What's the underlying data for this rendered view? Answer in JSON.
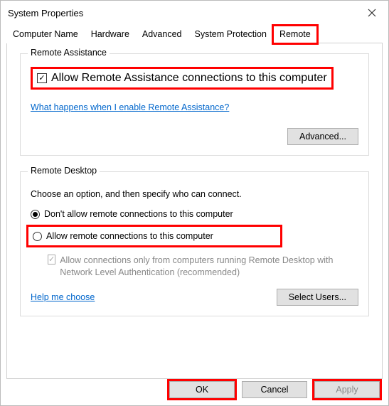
{
  "window": {
    "title": "System Properties"
  },
  "tabs": {
    "items": [
      {
        "label": "Computer Name"
      },
      {
        "label": "Hardware"
      },
      {
        "label": "Advanced"
      },
      {
        "label": "System Protection"
      },
      {
        "label": "Remote"
      }
    ],
    "active": 4,
    "highlight": 4
  },
  "remote_assistance": {
    "legend": "Remote Assistance",
    "checkbox_label": "Allow Remote Assistance connections to this computer",
    "checkbox_checked": true,
    "help_link": "What happens when I enable Remote Assistance?",
    "advanced_button": "Advanced..."
  },
  "remote_desktop": {
    "legend": "Remote Desktop",
    "instruction": "Choose an option, and then specify who can connect.",
    "options": [
      {
        "label": "Don't allow remote connections to this computer",
        "selected": true
      },
      {
        "label": "Allow remote connections to this computer",
        "selected": false
      }
    ],
    "nla_checkbox_label": "Allow connections only from computers running Remote Desktop with Network Level Authentication (recommended)",
    "nla_checked": true,
    "nla_enabled": false,
    "help_link": "Help me choose",
    "select_users_button": "Select Users..."
  },
  "buttons": {
    "ok": "OK",
    "cancel": "Cancel",
    "apply": "Apply"
  },
  "icons": {
    "close": "close-icon"
  },
  "colors": {
    "highlight": "#ff0000",
    "link": "#0066cc"
  }
}
